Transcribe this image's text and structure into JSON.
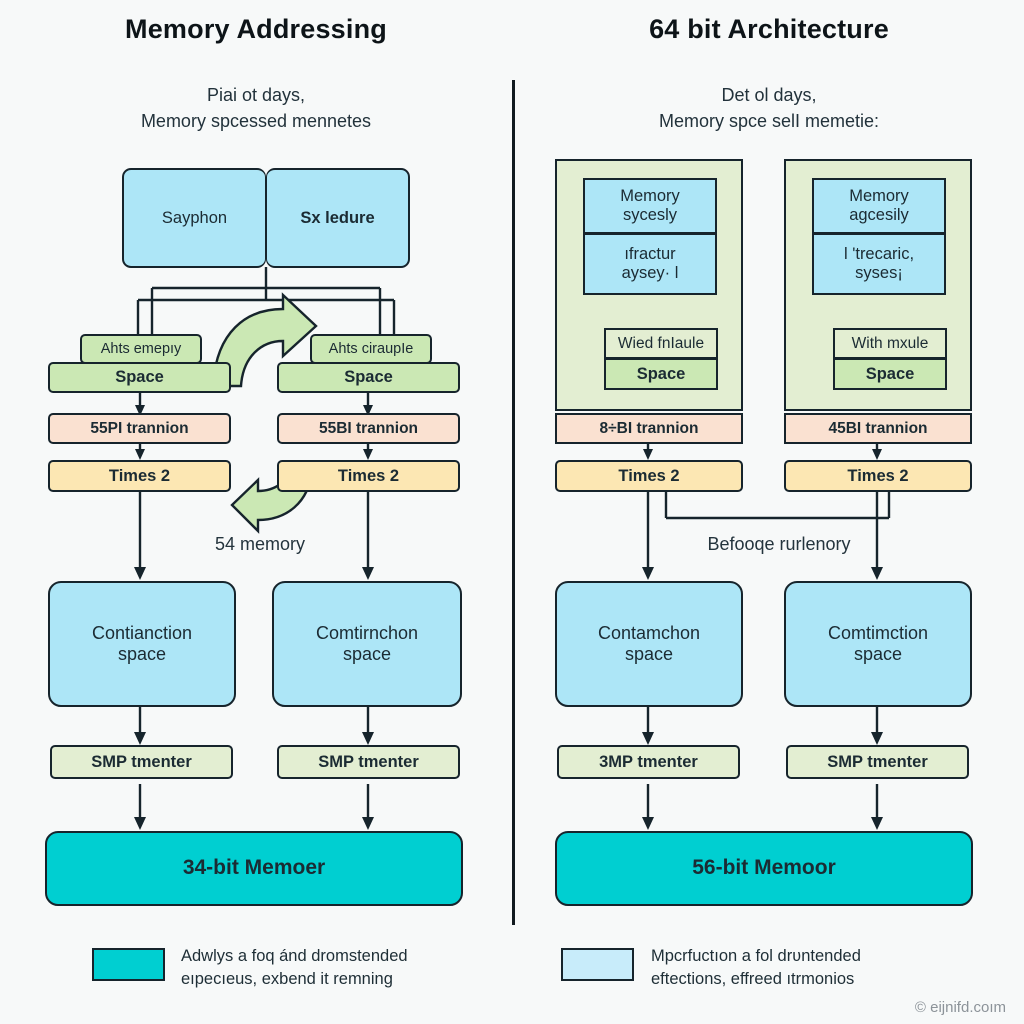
{
  "meta": {
    "watermark": "© eijnifd.coım",
    "colors": {
      "blue": "#ade6f7",
      "blue_light": "#c8ecfa",
      "green": "#cbe8b4",
      "green_pale": "#e3eed2",
      "peach": "#fae1d1",
      "yellow": "#fce7b3",
      "teal": "#00cfd1",
      "outline": "#16242c",
      "background": "#f7f9f9"
    }
  },
  "left": {
    "title": "Memory Addressing",
    "subtitle_line1": "Piai ot days,",
    "subtitle_line2": "Memory spcessed mennetes",
    "top_box": {
      "left_label": "Sayphon",
      "right_label": "Sx ledure"
    },
    "branches": [
      {
        "caption": "Ahts emepıy",
        "space_label": "Space",
        "transition_label": "55PI trannion",
        "times_label": "Times 2",
        "space_box_label_line1": "Contianction",
        "space_box_label_line2": "space",
        "counter_label": "SMP tmenter"
      },
      {
        "caption": "Ahts ciraupIe",
        "space_label": "Space",
        "transition_label": "55BI trannion",
        "times_label": "Times 2",
        "space_box_label_line1": "Comtirnchon",
        "space_box_label_line2": "space",
        "counter_label": "SMP tmenter"
      }
    ],
    "mid_note": "54 memory",
    "memory_bar": "34-bit Memoer",
    "legend": {
      "swatch_color": "#00cfd1",
      "line1": "Adwlys a foq ánd dromstended",
      "line2": "eıpecıeus, exbend it remning"
    }
  },
  "right": {
    "title": "64 bit Architecture",
    "subtitle_line1": "Det ol days,",
    "subtitle_line2": "Memory spce selI memetie:",
    "branches": [
      {
        "head_line1": "Memory",
        "head_line2": "sycesly",
        "sub_line1": "ıfractur",
        "sub_line2": "aysey· l",
        "module_label": "Wied fnIaule",
        "space_label": "Space",
        "transition_label": "8÷BI trannion",
        "times_label": "Times 2",
        "space_box_label_line1": "Contamchon",
        "space_box_label_line2": "space",
        "counter_label": "3MP tmenter"
      },
      {
        "head_line1": "Memory",
        "head_line2": "agcesily",
        "sub_line1": "l 'trecaric,",
        "sub_line2": "syses¡",
        "module_label": "With mxule",
        "space_label": "Space",
        "transition_label": "45BI trannion",
        "times_label": "Times 2",
        "space_box_label_line1": "Comtimction",
        "space_box_label_line2": "space",
        "counter_label": "SMP tmenter"
      }
    ],
    "mid_note": "Befooqe rurlenory",
    "memory_bar": "56-bit Memoor",
    "legend": {
      "swatch_color": "#c8ecfa",
      "line1": "Mpcrfuctıon a fol drʋntended",
      "line2": "eftections, effreed ıtrmonios"
    }
  }
}
